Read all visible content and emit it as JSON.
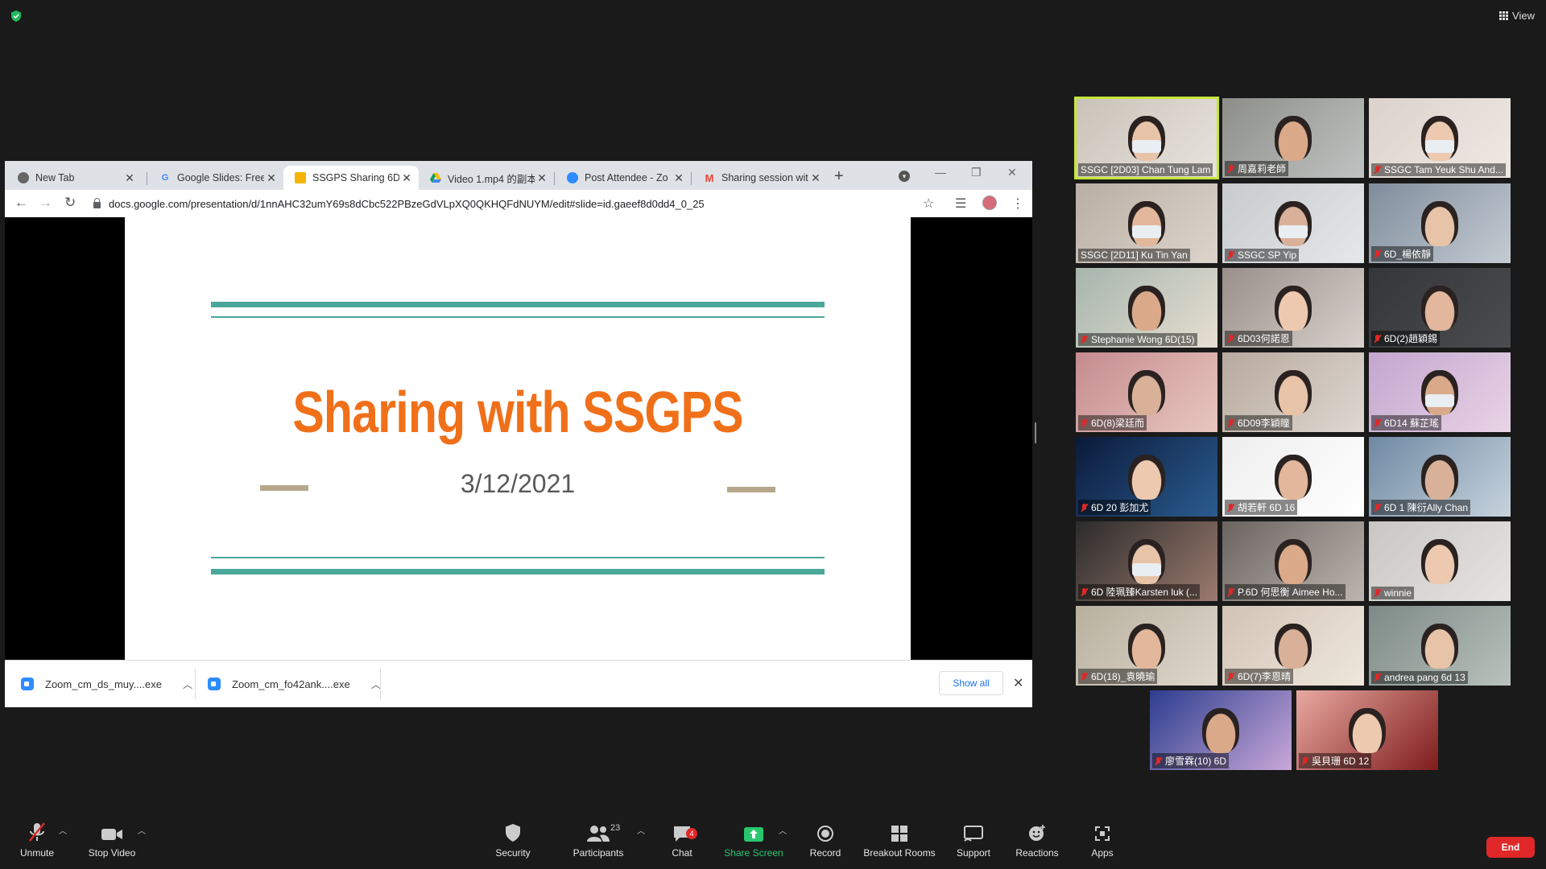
{
  "header": {
    "view_label": "View"
  },
  "browser": {
    "tabs": [
      {
        "title": "New Tab",
        "favicon": "chrome-icon"
      },
      {
        "title": "Google Slides: Free",
        "favicon": "google-icon"
      },
      {
        "title": "SSGPS Sharing 6D",
        "favicon": "slides-icon",
        "active": true
      },
      {
        "title": "Video 1.mp4 的副本",
        "favicon": "drive-icon"
      },
      {
        "title": "Post Attendee - Zo",
        "favicon": "zoom-icon"
      },
      {
        "title": "Sharing session wit",
        "favicon": "gmail-icon"
      }
    ],
    "url": "docs.google.com/presentation/d/1nnAHC32umY69s8dCbc522PBzeGdVLpXQ0QKHQFdNUYM/edit#slide=id.gaeef8d0dd4_0_25"
  },
  "slide": {
    "title": "Sharing with SSGPS",
    "date": "3/12/2021",
    "accent_color": "#f0701a",
    "line_color": "#4ba79a"
  },
  "downloads": {
    "items": [
      {
        "name": "Zoom_cm_ds_muy....exe"
      },
      {
        "name": "Zoom_cm_fo42ank....exe"
      }
    ],
    "show_all": "Show all"
  },
  "participants": [
    {
      "name": "SSGC [2D03] Chan Tung Lam",
      "muted": false,
      "speaking": true
    },
    {
      "name": "周嘉莉老師",
      "muted": true
    },
    {
      "name": "SSGC Tam Yeuk Shu And...",
      "muted": true
    },
    {
      "name": "SSGC [2D11] Ku Tin Yan",
      "muted": false
    },
    {
      "name": "SSGC SP Yip",
      "muted": true
    },
    {
      "name": "6D_楊依靜",
      "muted": true
    },
    {
      "name": "Stephanie Wong 6D(15)",
      "muted": true
    },
    {
      "name": "6D03何諾恩",
      "muted": true
    },
    {
      "name": "6D(2)趙穎錫",
      "muted": true
    },
    {
      "name": "6D(8)梁廷而",
      "muted": true
    },
    {
      "name": "6D09李穎瞳",
      "muted": true
    },
    {
      "name": "6D14 蘇芷瑤",
      "muted": true
    },
    {
      "name": "6D 20 彭加尤",
      "muted": true
    },
    {
      "name": "胡若軒 6D 16",
      "muted": true
    },
    {
      "name": "6D 1 陳衍Ally Chan",
      "muted": true
    },
    {
      "name": "6D 陸珮臻Karsten luk (...",
      "muted": true
    },
    {
      "name": "P.6D 何思衡 Aimee Ho...",
      "muted": true
    },
    {
      "name": "winnie",
      "muted": true
    },
    {
      "name": "6D(18)_袁曉瑜",
      "muted": true
    },
    {
      "name": "6D(7)李恩晴",
      "muted": true
    },
    {
      "name": "andrea pang 6d 13",
      "muted": true
    },
    {
      "name": "廖雪霖(10) 6D",
      "muted": true
    },
    {
      "name": "吳貝珊 6D 12",
      "muted": true
    }
  ],
  "toolbar": {
    "unmute": "Unmute",
    "stop_video": "Stop Video",
    "security": "Security",
    "participants": "Participants",
    "participants_count": "23",
    "chat": "Chat",
    "chat_badge": "4",
    "share_screen": "Share Screen",
    "record": "Record",
    "breakout_rooms": "Breakout Rooms",
    "support": "Support",
    "reactions": "Reactions",
    "apps": "Apps",
    "end": "End"
  }
}
